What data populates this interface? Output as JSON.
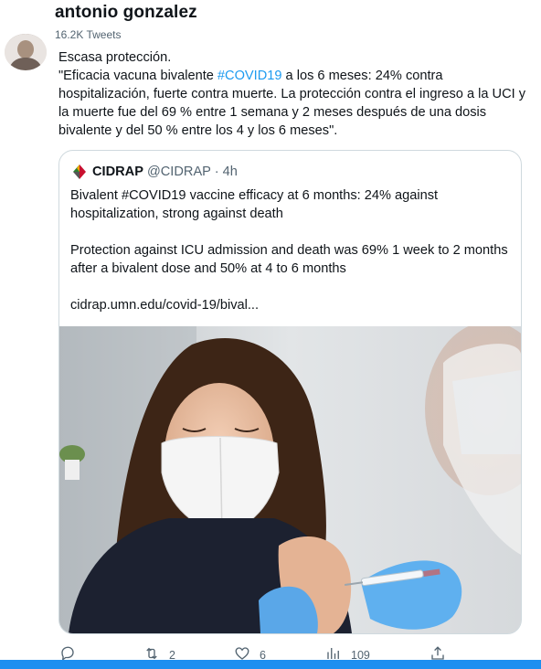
{
  "profile": {
    "name": "antonio gonzalez",
    "tweet_count": "16.2K Tweets"
  },
  "tweet": {
    "line1": "Escasa protección.",
    "quote_pre": "\"Eficacia vacuna bivalente ",
    "hashtag": "#COVID19",
    "quote_post": " a los 6 meses: 24% contra hospitalización, fuerte contra muerte. La protección contra el ingreso a la UCI y la muerte fue del 69 % entre 1 semana y 2 meses después de una dosis bivalente y del 50 % entre los 4 y los 6 meses\"."
  },
  "quoted_tweet": {
    "name": "CIDRAP",
    "handle_time": "@CIDRAP · 4h",
    "para1": "Bivalent #COVID19 vaccine efficacy at 6 months: 24% against hospitalization, strong against death",
    "para2": "Protection against ICU admission and death was 69% 1 week to 2 months after a bivalent dose and 50% at 4 to 6 months",
    "link": "cidrap.umn.edu/covid-19/bival..."
  },
  "actions": {
    "retweets": "2",
    "likes": "6",
    "views": "109"
  },
  "colors": {
    "accent": "#1d9bf0",
    "secondary_text": "#536471",
    "border": "#cfd9de",
    "taskbar": "#1d8ff0"
  },
  "icons": [
    "reply-icon",
    "retweet-icon",
    "like-icon",
    "views-icon",
    "share-icon",
    "cidrap-logo-icon"
  ]
}
